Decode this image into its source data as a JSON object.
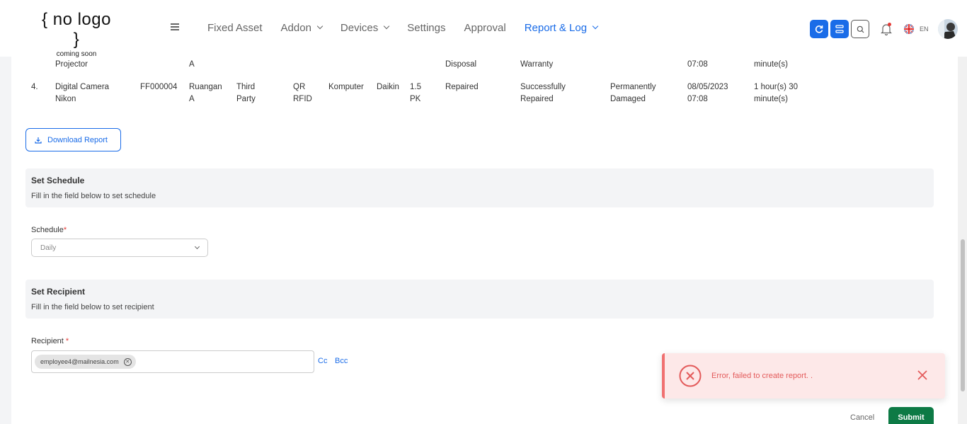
{
  "brand": {
    "logo_main": "{ no logo }",
    "logo_sub": "coming soon"
  },
  "nav": {
    "items": [
      {
        "label": "Fixed Asset",
        "dropdown": false,
        "active": false
      },
      {
        "label": "Addon",
        "dropdown": true,
        "active": false
      },
      {
        "label": "Devices",
        "dropdown": true,
        "active": false
      },
      {
        "label": "Settings",
        "dropdown": false,
        "active": false
      },
      {
        "label": "Approval",
        "dropdown": false,
        "active": false
      },
      {
        "label": "Report & Log",
        "dropdown": true,
        "active": true
      }
    ]
  },
  "topbar": {
    "lang": "EN",
    "accent": "#1a6ce8"
  },
  "table": {
    "rows": [
      {
        "no": "",
        "name": "Projector",
        "code": "",
        "location": "A",
        "vendor": "",
        "tag": "",
        "category": "",
        "brand": "",
        "capacity": "",
        "status": "Disposal",
        "condition": "Warranty",
        "reason": "",
        "time": "07:08",
        "duration": "minute(s)"
      },
      {
        "no": "4.",
        "name": "Digital Camera Nikon",
        "code": "FF000004",
        "location": "Ruangan A",
        "vendor": "Third Party",
        "tag": "QR RFID",
        "category": "Komputer",
        "brand": "Daikin",
        "capacity": "1.5 PK",
        "status": "Repaired",
        "condition": "Successfully Repaired",
        "reason": "Permanently Damaged",
        "time": "08/05/2023 07:08",
        "duration": "1 hour(s) 30 minute(s)"
      }
    ]
  },
  "download_label": "Download Report",
  "schedule_section": {
    "title": "Set Schedule",
    "subtitle": "Fill in the field below to set schedule"
  },
  "schedule_field": {
    "label": "Schedule",
    "required_mark": "*",
    "value": "Daily"
  },
  "recipient_section": {
    "title": "Set Recipient",
    "subtitle": "Fill in the field below to set recipient"
  },
  "recipient_field": {
    "label": "Recipient",
    "required_mark": "*",
    "chips": [
      "employee4@mailnesia.com"
    ],
    "cc": "Cc",
    "bcc": "Bcc"
  },
  "actions": {
    "cancel": "Cancel",
    "submit": "Submit"
  },
  "toast": {
    "message": "Error, failed to create report. .",
    "color": "#e35a5a"
  }
}
